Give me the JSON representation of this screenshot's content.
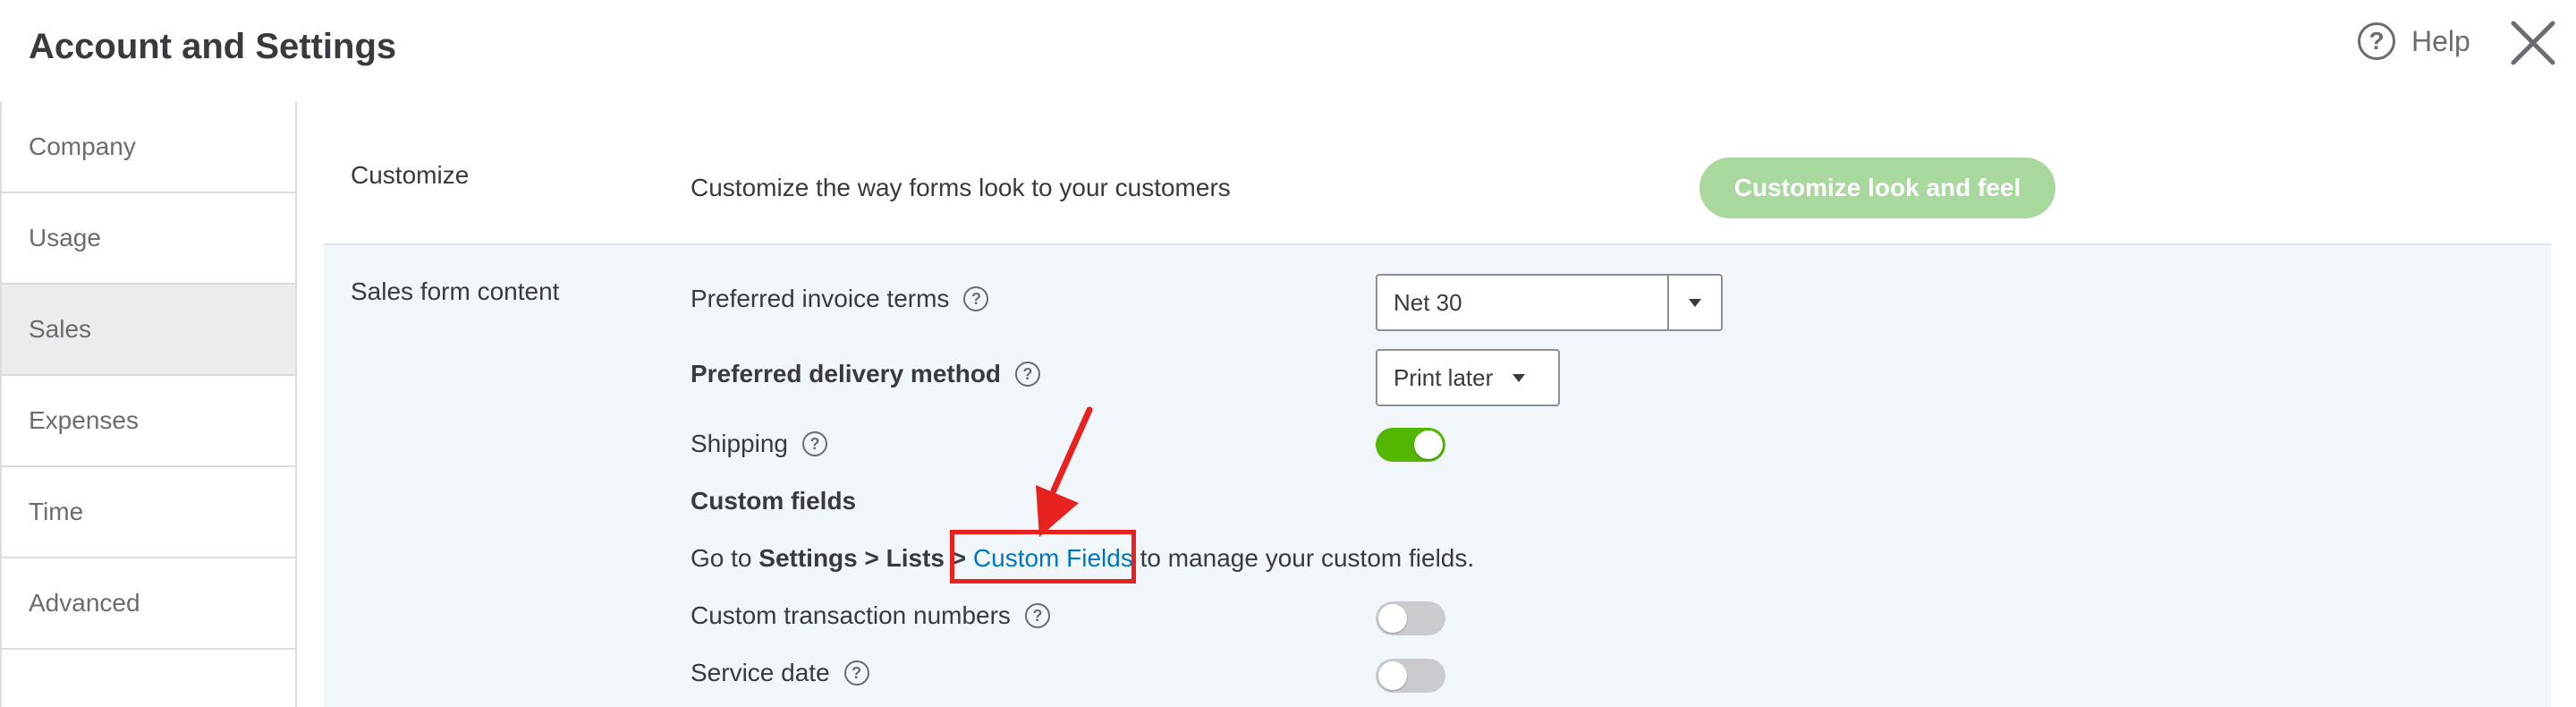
{
  "header": {
    "title": "Account and Settings",
    "help_label": "Help"
  },
  "sidebar": {
    "items": [
      {
        "label": "Company",
        "active": false
      },
      {
        "label": "Usage",
        "active": false
      },
      {
        "label": "Sales",
        "active": true
      },
      {
        "label": "Expenses",
        "active": false
      },
      {
        "label": "Time",
        "active": false
      },
      {
        "label": "Advanced",
        "active": false
      }
    ]
  },
  "customize": {
    "section_label": "Customize",
    "description": "Customize the way forms look to your customers",
    "button_label": "Customize look and feel"
  },
  "sales_form": {
    "section_label": "Sales form content",
    "invoice_terms": {
      "label": "Preferred invoice terms",
      "value": "Net 30"
    },
    "delivery_method": {
      "label": "Preferred delivery method",
      "value": "Print later"
    },
    "shipping": {
      "label": "Shipping",
      "enabled": true
    },
    "custom_fields": {
      "heading": "Custom fields",
      "text_prefix": "Go to ",
      "path_bold": "Settings > Lists > ",
      "link_label": "Custom Fields",
      "text_suffix": " to manage your custom fields."
    },
    "custom_txn_numbers": {
      "label": "Custom transaction numbers",
      "enabled": false
    },
    "service_date": {
      "label": "Service date",
      "enabled": false
    }
  },
  "colors": {
    "accent_green": "#53b700",
    "button_green_disabled": "#a8d89e",
    "link_blue": "#0077c5",
    "annotation_red": "#e8221f"
  },
  "icons": [
    "help-icon",
    "close-icon",
    "question-icon",
    "dropdown-arrow-icon"
  ]
}
